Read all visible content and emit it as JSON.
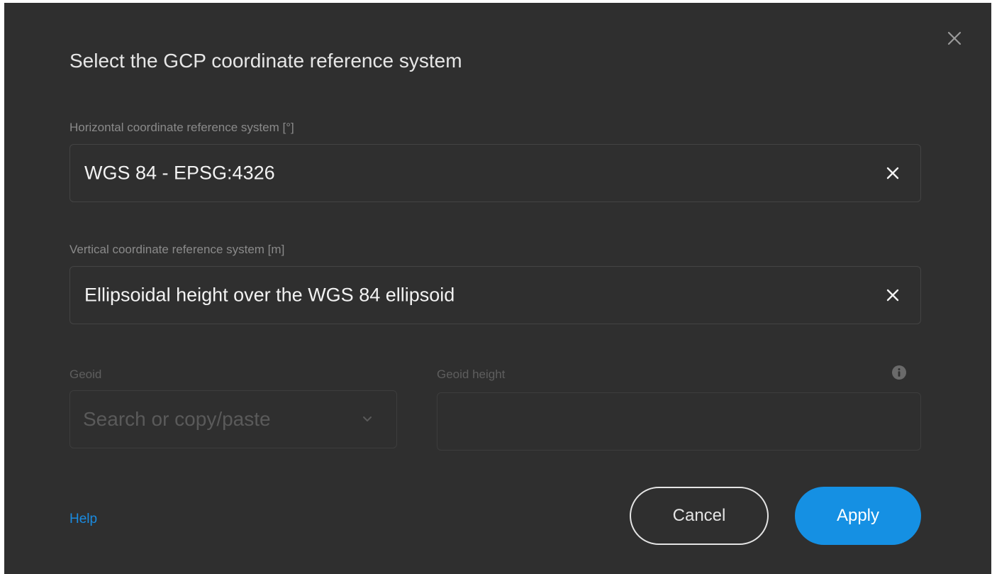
{
  "dialog": {
    "title": "Select the GCP coordinate reference system",
    "close_icon": "close-icon"
  },
  "horizontal": {
    "label": "Horizontal coordinate reference system [°]",
    "value": "WGS 84 - EPSG:4326",
    "clear_icon": "close-icon"
  },
  "vertical": {
    "label": "Vertical coordinate reference system [m]",
    "value": "Ellipsoidal height over the WGS 84 ellipsoid",
    "clear_icon": "close-icon"
  },
  "geoid": {
    "label": "Geoid",
    "placeholder": "Search or copy/paste",
    "dropdown_icon": "chevron-down-icon",
    "disabled": true
  },
  "geoid_height": {
    "label": "Geoid height",
    "value": "",
    "info_icon": "info-icon",
    "disabled": true
  },
  "footer": {
    "help_label": "Help",
    "cancel_label": "Cancel",
    "apply_label": "Apply"
  },
  "colors": {
    "background": "#2f2f2f",
    "accent": "#1590e3",
    "link": "#1a8be0"
  }
}
